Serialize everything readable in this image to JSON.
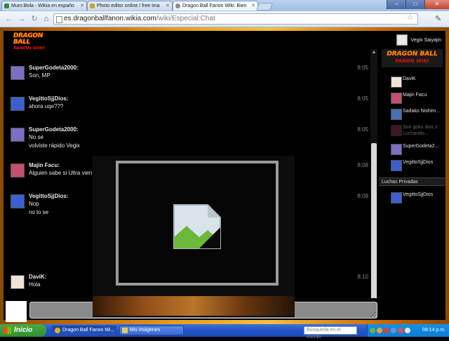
{
  "browser": {
    "tabs": [
      {
        "title": "Muro:Bola - Wikia en españo",
        "icon_color": "#2b8c3a"
      },
      {
        "title": "Photo editor online / free ima",
        "icon_color": "#c9a227"
      },
      {
        "title": "Dragon Ball Fanon Wiki: Bien",
        "icon_color": "#8a8a8a"
      }
    ],
    "url_host": "es.dragonballfanon.wikia.com",
    "url_path": "/wiki/Especial:Chat",
    "window_buttons": {
      "minimize": "–",
      "maximize": "□",
      "close": "✕"
    }
  },
  "chat": {
    "logo": {
      "line1": "DRAGON BALL",
      "line2": "FANON WIKI"
    },
    "current_user": "Vegix Saiyajin",
    "messages": [
      {
        "user": "SuperGodeta2000:",
        "lines": [
          "Son, MP"
        ],
        "time": "8:05",
        "avatar_color": "#7b6fc4"
      },
      {
        "user": "VegittoSjjDios:",
        "lines": [
          "ahora uqe???"
        ],
        "time": "8:05",
        "avatar_color": "#3c5fd0"
      },
      {
        "user": "SuperGodeta2000:",
        "lines": [
          "No se",
          "volviste rápido Vegix"
        ],
        "time": "8:05",
        "avatar_color": "#7b6fc4"
      },
      {
        "user": "Majin Facu:",
        "lines": [
          "Alguien sabe si Ultra vien"
        ],
        "time": "8:08",
        "avatar_color": "#c24f6e"
      },
      {
        "user": "VegittoSjjDios:",
        "lines": [
          "Nop",
          "no lo se"
        ],
        "time": "8:09",
        "avatar_color": "#3c5fd0"
      },
      {
        "user": "DaviK:",
        "lines": [
          "Hola"
        ],
        "time": "8:10",
        "avatar_color": "#f1e4d6"
      }
    ],
    "input_value": ""
  },
  "sidebar": {
    "logo": {
      "line1": "DRAGON BALL",
      "line2": "FANON WIKI"
    },
    "users": [
      {
        "name": "DaviK",
        "avatar_color": "#f1e4d6",
        "idle": false
      },
      {
        "name": "Majin Facu",
        "avatar_color": "#c24f6e",
        "idle": false
      },
      {
        "name": "Sadako Nishim...",
        "avatar_color": "#4a6fb8",
        "idle": false
      },
      {
        "name": "Son goku dios z Luchando...",
        "avatar_color": "#a03a5a",
        "idle": true
      },
      {
        "name": "SuperGodeta2...",
        "avatar_color": "#7b6fc4",
        "idle": false
      },
      {
        "name": "VegittoSjjDios",
        "avatar_color": "#3c5fd0",
        "idle": false
      }
    ],
    "private_title": "Luchas Privadas",
    "private_users": [
      {
        "name": "VegittoSjjDios",
        "avatar_color": "#3c5fd0"
      }
    ]
  },
  "taskbar": {
    "start_label": "Inicio",
    "items": [
      {
        "label": "Dragon Ball Fanon Wi...",
        "icon_color": "#e0b020"
      },
      {
        "label": "Mis imágenes",
        "icon_color": "#e8c85a"
      }
    ],
    "search_placeholder": "Búsqueda en el escrito",
    "clock": "08:14 p.m."
  },
  "colors": {
    "accent_orange": "#f5a000",
    "chat_bg": "#000000",
    "taskbar_blue": "#2356c8"
  }
}
